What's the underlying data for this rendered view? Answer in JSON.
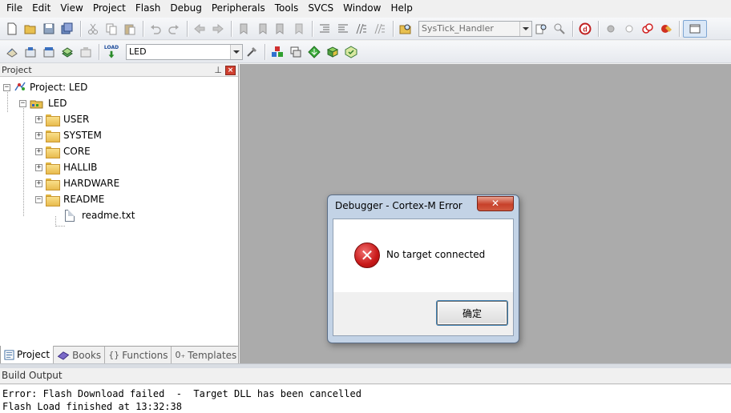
{
  "menu": [
    "File",
    "Edit",
    "View",
    "Project",
    "Flash",
    "Debug",
    "Peripherals",
    "Tools",
    "SVCS",
    "Window",
    "Help"
  ],
  "toolbar1": {
    "function_combo": "SysTick_Handler"
  },
  "toolbar2": {
    "load_label": "LOAD",
    "target_combo": "LED"
  },
  "project_panel": {
    "title": "Project",
    "pin": "ᵖ",
    "close": "✕",
    "root": "Project: LED",
    "target": "LED",
    "groups": [
      "USER",
      "SYSTEM",
      "CORE",
      "HALLIB",
      "HARDWARE",
      "README"
    ],
    "file": "readme.txt",
    "tabs": [
      {
        "label": "Project",
        "icon": "project-icon"
      },
      {
        "label": "Books",
        "icon": "books-icon"
      },
      {
        "label": "Functions",
        "icon": "functions-icon"
      },
      {
        "label": "Templates",
        "icon": "templates-icon"
      }
    ]
  },
  "build_output": {
    "title": "Build Output",
    "lines": [
      "Error: Flash Download failed  -  Target DLL has been cancelled",
      "Flash Load finished at 13:32:38"
    ]
  },
  "dialog": {
    "title": "Debugger - Cortex-M Error",
    "close": "✕",
    "message": "No target connected",
    "ok_button": "确定"
  }
}
